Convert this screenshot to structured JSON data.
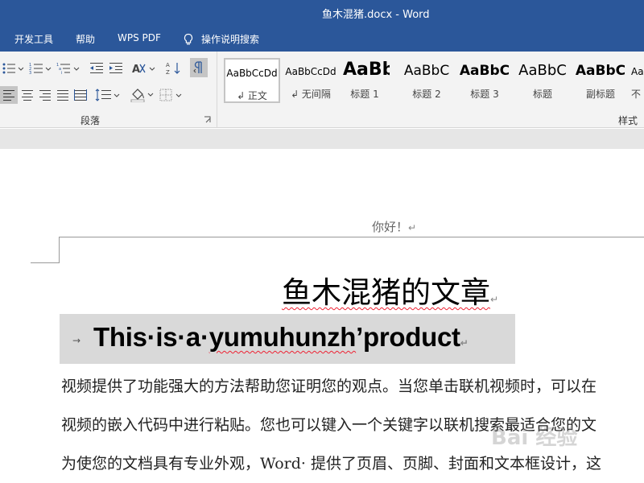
{
  "window": {
    "title": "鱼木混猪.docx  -  Word"
  },
  "tabs": [
    "开发工具",
    "帮助",
    "WPS PDF"
  ],
  "tell_me": {
    "label": "操作说明搜索",
    "icon": "lightbulb-icon"
  },
  "ribbon": {
    "paragraph_group": "段落",
    "styles_group": "样式",
    "styles": [
      {
        "sample": "AaBbCcDd",
        "name": "↲ 正文"
      },
      {
        "sample": "AaBbCcDd",
        "name": "↲ 无间隔"
      },
      {
        "sample": "AaBb",
        "name": "标题 1"
      },
      {
        "sample": "AaBbC",
        "name": "标题 2"
      },
      {
        "sample": "AaBbC",
        "name": "标题 3"
      },
      {
        "sample": "AaBbC",
        "name": "标题"
      },
      {
        "sample": "AaBbC",
        "name": "副标题"
      },
      {
        "sample": "Aa",
        "name": "不"
      }
    ]
  },
  "document": {
    "header": "你好！",
    "heading": "鱼木混猪的文章",
    "subtitle_parts": [
      "This·is·a·",
      "yumuhunzh",
      "’",
      "product"
    ],
    "body_lines": [
      "视频提供了功能强大的方法帮助您证明您的观点。当您单击联机视频时，可以在",
      "视频的嵌入代码中进行粘贴。您也可以键入一个关键字以联机搜索最适合您的文",
      "为使您的文档具有专业外观，Word· 提供了页眉、页脚、封面和文本框设计，这"
    ],
    "paragraph_mark": "↵",
    "tab_arrow": "→"
  },
  "watermark": {
    "text": "Bai 经验",
    "icon": "baidu-paw-icon"
  },
  "colors": {
    "title_bar": "#2b579a",
    "ribbon_bg": "#f3f3f3",
    "subtitle_shading": "#d9d9d9",
    "spell_squiggle": "#e23"
  }
}
